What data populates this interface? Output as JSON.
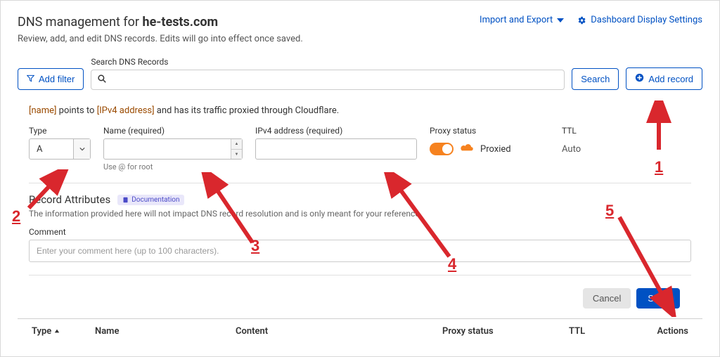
{
  "header": {
    "title_prefix": "DNS management for ",
    "domain": "he-tests.com",
    "subtitle": "Review, add, and edit DNS records. Edits will go into effect once saved.",
    "import_export": "Import and Export",
    "display_settings": "Dashboard Display Settings"
  },
  "toolbar": {
    "add_filter": "Add filter",
    "search_label": "Search DNS Records",
    "search_btn": "Search",
    "add_record": "Add record"
  },
  "instruction": {
    "ph_name": "[name]",
    "mid1": " points to ",
    "ph_ip": "[IPv4 address]",
    "mid2": " and has its traffic proxied through Cloudflare."
  },
  "form": {
    "type_label": "Type",
    "type_value": "A",
    "name_label": "Name (required)",
    "name_hint": "Use @ for root",
    "ip_label": "IPv4 address (required)",
    "proxy_label": "Proxy status",
    "proxy_value": "Proxied",
    "ttl_label": "TTL",
    "ttl_value": "Auto"
  },
  "attrs": {
    "title": "Record Attributes",
    "doc": "Documentation",
    "sub": "The information provided here will not impact DNS record resolution and is only meant for your reference.",
    "comment_label": "Comment",
    "comment_placeholder": "Enter your comment here (up to 100 characters)."
  },
  "actions": {
    "cancel": "Cancel",
    "save": "Save"
  },
  "table": {
    "type": "Type",
    "name": "Name",
    "content": "Content",
    "proxy": "Proxy status",
    "ttl": "TTL",
    "actions": "Actions"
  },
  "annotations": {
    "n1": "1",
    "n2": "2",
    "n3": "3",
    "n4": "4",
    "n5": "5"
  }
}
